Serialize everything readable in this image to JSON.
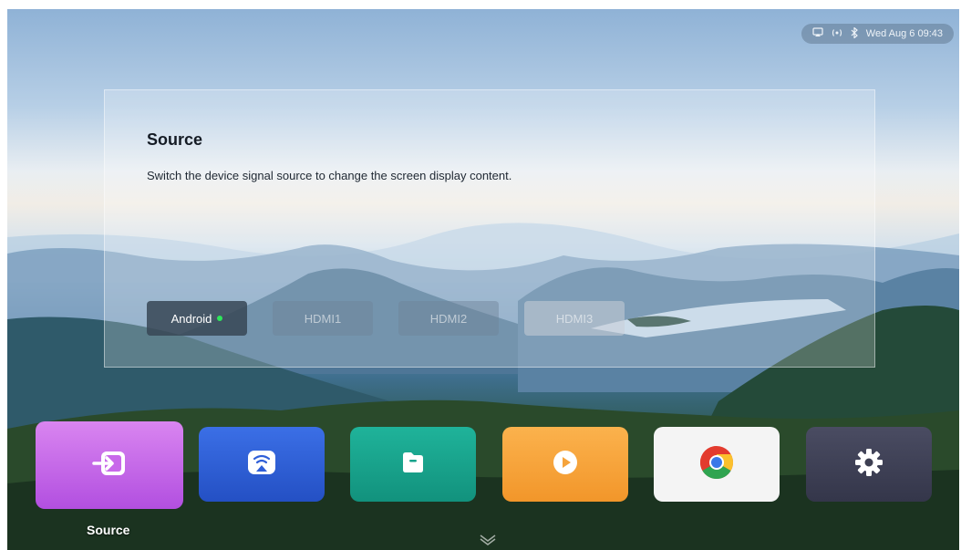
{
  "status_bar": {
    "icons": [
      "screencast-icon",
      "wireless-icon",
      "bluetooth-icon"
    ],
    "datetime": "Wed Aug 6 09:43"
  },
  "panel": {
    "title": "Source",
    "description": "Switch the device signal source to change the screen display content.",
    "sources": [
      {
        "label": "Android",
        "active": true
      },
      {
        "label": "HDMI1",
        "active": false
      },
      {
        "label": "HDMI2",
        "active": false
      },
      {
        "label": "HDMI3",
        "active": false
      }
    ]
  },
  "dock": {
    "items": [
      {
        "name": "source",
        "icon": "input-source-icon",
        "color": "#c868ea"
      },
      {
        "name": "screencast",
        "icon": "screencast-icon",
        "color": "#2f5fd8"
      },
      {
        "name": "files",
        "icon": "folder-icon",
        "color": "#17a38c"
      },
      {
        "name": "media",
        "icon": "play-icon",
        "color": "#f5a33b"
      },
      {
        "name": "chrome",
        "icon": "chrome-icon",
        "color": "#f4f4f4"
      },
      {
        "name": "settings",
        "icon": "gear-icon",
        "color": "#3d3f52"
      }
    ],
    "selected_label": "Source"
  }
}
